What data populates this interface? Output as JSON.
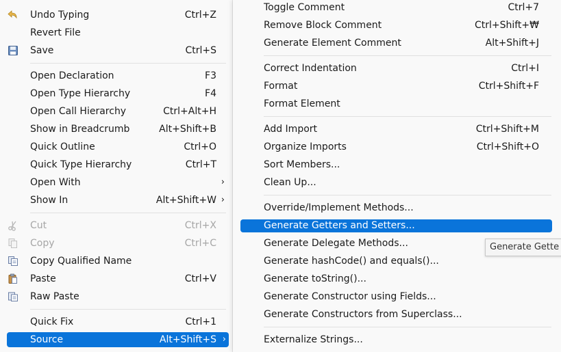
{
  "main_menu": {
    "undo": {
      "label": "Undo Typing",
      "accel": "Ctrl+Z"
    },
    "revert": {
      "label": "Revert File",
      "accel": ""
    },
    "save": {
      "label": "Save",
      "accel": "Ctrl+S"
    },
    "open_declaration": {
      "label": "Open Declaration",
      "accel": "F3"
    },
    "open_type_hierarchy": {
      "label": "Open Type Hierarchy",
      "accel": "F4"
    },
    "open_call_hierarchy": {
      "label": "Open Call Hierarchy",
      "accel": "Ctrl+Alt+H"
    },
    "show_breadcrumb": {
      "label": "Show in Breadcrumb",
      "accel": "Alt+Shift+B"
    },
    "quick_outline": {
      "label": "Quick Outline",
      "accel": "Ctrl+O"
    },
    "quick_type_hierarchy": {
      "label": "Quick Type Hierarchy",
      "accel": "Ctrl+T"
    },
    "open_with": {
      "label": "Open With",
      "accel": ""
    },
    "show_in": {
      "label": "Show In",
      "accel": "Alt+Shift+W"
    },
    "cut": {
      "label": "Cut",
      "accel": "Ctrl+X"
    },
    "copy": {
      "label": "Copy",
      "accel": "Ctrl+C"
    },
    "copy_qualified": {
      "label": "Copy Qualified Name",
      "accel": ""
    },
    "paste": {
      "label": "Paste",
      "accel": "Ctrl+V"
    },
    "raw_paste": {
      "label": "Raw Paste",
      "accel": ""
    },
    "quick_fix": {
      "label": "Quick Fix",
      "accel": "Ctrl+1"
    },
    "source": {
      "label": "Source",
      "accel": "Alt+Shift+S"
    },
    "chevron": "›"
  },
  "sub_menu": {
    "toggle_comment": {
      "label": "Toggle Comment",
      "accel": "Ctrl+7"
    },
    "remove_block_comment": {
      "label": "Remove Block Comment",
      "accel": "Ctrl+Shift+₩"
    },
    "generate_element_comment": {
      "label": "Generate Element Comment",
      "accel": "Alt+Shift+J"
    },
    "correct_indentation": {
      "label": "Correct Indentation",
      "accel": "Ctrl+I"
    },
    "format": {
      "label": "Format",
      "accel": "Ctrl+Shift+F"
    },
    "format_element": {
      "label": "Format Element",
      "accel": ""
    },
    "add_import": {
      "label": "Add Import",
      "accel": "Ctrl+Shift+M"
    },
    "organize_imports": {
      "label": "Organize Imports",
      "accel": "Ctrl+Shift+O"
    },
    "sort_members": {
      "label": "Sort Members...",
      "accel": ""
    },
    "clean_up": {
      "label": "Clean Up...",
      "accel": ""
    },
    "override_methods": {
      "label": "Override/Implement Methods...",
      "accel": ""
    },
    "getters_setters": {
      "label": "Generate Getters and Setters...",
      "accel": ""
    },
    "delegate_methods": {
      "label": "Generate Delegate Methods...",
      "accel": ""
    },
    "hashcode_equals": {
      "label": "Generate hashCode() and equals()...",
      "accel": ""
    },
    "to_string": {
      "label": "Generate toString()...",
      "accel": ""
    },
    "constructor_fields": {
      "label": "Generate Constructor using Fields...",
      "accel": ""
    },
    "constructor_superclass": {
      "label": "Generate Constructors from Superclass...",
      "accel": ""
    },
    "externalize_strings": {
      "label": "Externalize Strings...",
      "accel": ""
    }
  },
  "tooltip": {
    "text": "Generate Gette"
  },
  "colors": {
    "selection": "#0a74da",
    "disabled": "#a6a6a6",
    "menu_bg": "#f9f9f9"
  },
  "icons": {
    "undo": "undo-arrow-icon",
    "save": "floppy-disk-icon",
    "cut": "scissors-icon",
    "copy": "copy-icon",
    "copy_qualified": "copy-qualified-icon",
    "paste": "clipboard-paste-icon",
    "raw_paste": "raw-paste-icon"
  }
}
